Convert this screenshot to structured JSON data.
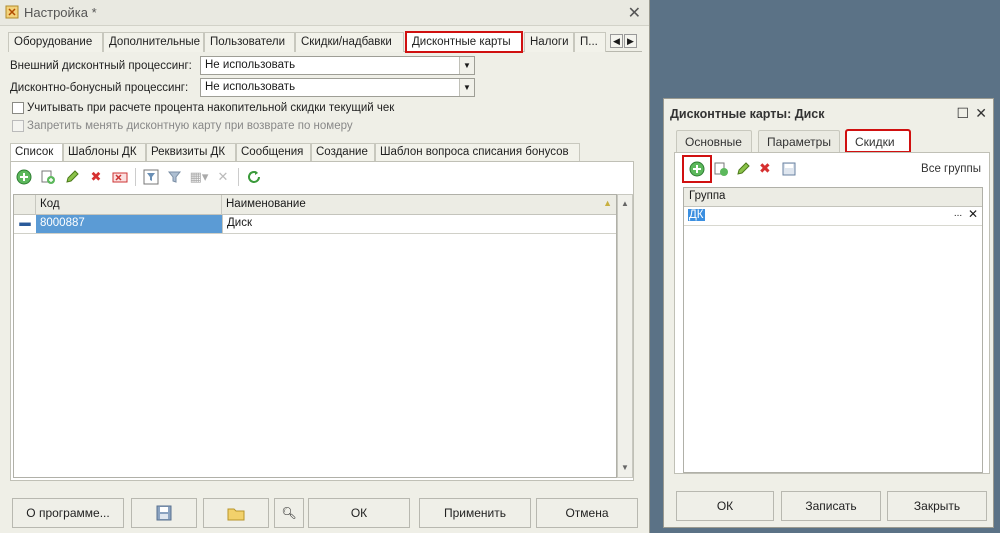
{
  "main": {
    "title": "Настройка *",
    "tabs": [
      "Оборудование",
      "Дополнительные",
      "Пользователи",
      "Скидки/надбавки",
      "Дисконтные карты",
      "Налоги",
      "П..."
    ],
    "ext_processing_label": "Внешний дисконтный процессинг:",
    "ext_processing_value": "Не использовать",
    "bonus_processing_label": "Дисконтно-бонусный процессинг:",
    "bonus_processing_value": "Не использовать",
    "check_current_receipt": "Учитывать при расчете процента накопительной скидки текущий чек",
    "forbid_change_card": "Запретить менять дисконтную карту при возврате по номеру",
    "inner_tabs": [
      "Список",
      "Шаблоны ДК",
      "Реквизиты ДК",
      "Сообщения",
      "Создание",
      "Шаблон вопроса списания бонусов"
    ],
    "grid": {
      "headers": [
        "Код",
        "Наименование"
      ],
      "rows": [
        {
          "code": "8000887",
          "name": "Диск"
        }
      ]
    },
    "buttons": {
      "about": "О программе...",
      "ok": "ОК",
      "apply": "Применить",
      "cancel": "Отмена"
    }
  },
  "dialog": {
    "title": "Дисконтные карты: Диск",
    "tabs": [
      "Основные",
      "Параметры",
      "Скидки"
    ],
    "all_groups": "Все группы",
    "grid_header": "Группа",
    "row_value": "ДК",
    "buttons": {
      "ok": "ОК",
      "save": "Записать",
      "close": "Закрыть"
    }
  },
  "colors": {
    "highlight": "#d01010",
    "selection": "#5b9bd5",
    "window_bg": "#efefe7"
  }
}
